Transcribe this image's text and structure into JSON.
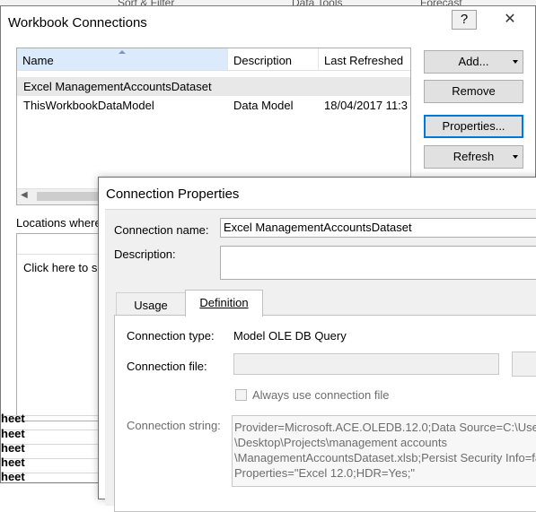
{
  "ribbon": {
    "groups": [
      "Sort & Filter",
      "Data Tools",
      "Forecast"
    ]
  },
  "workbook_connections": {
    "title": "Workbook Connections",
    "help_label": "?",
    "close_label": "✕",
    "columns": [
      "Name",
      "Description",
      "Last Refreshed"
    ],
    "rows": [
      {
        "name": "Excel ManagementAccountsDataset",
        "description": "",
        "last_refreshed": ""
      },
      {
        "name": "ThisWorkbookDataModel",
        "description": "Data Model",
        "last_refreshed": "18/04/2017  11:3"
      }
    ],
    "buttons": {
      "add": "Add...",
      "remove": "Remove",
      "properties": "Properties...",
      "refresh": "Refresh"
    },
    "locations_label": "Locations where",
    "locations_hint": "Click here to s",
    "sheet_rows": [
      "heet",
      "heet",
      "heet",
      "heet",
      "heet"
    ]
  },
  "connection_properties": {
    "title": "Connection Properties",
    "connection_name_label": "Connection name:",
    "connection_name_value": "Excel ManagementAccountsDataset",
    "description_label": "Description:",
    "tabs": [
      "Usage",
      "Definition"
    ],
    "active_tab": "Definition",
    "connection_type_label": "Connection type:",
    "connection_type_value": "Model OLE DB Query",
    "connection_file_label": "Connection file:",
    "always_use_label": "Always use connection file",
    "connection_string_label": "Connection string:",
    "connection_string_lines": [
      "Provider=Microsoft.ACE.OLEDB.12.0;Data Source=C:\\User",
      "\\Desktop\\Projects\\management accounts",
      "\\ManagementAccountsDataset.xlsb;Persist Security Info=fa",
      "Properties=\"Excel 12.0;HDR=Yes;\""
    ]
  },
  "colors": {
    "focus_border": "#0078d7",
    "header_selected": "#dcebfc",
    "dialog_bg": "#f0f0f0"
  }
}
